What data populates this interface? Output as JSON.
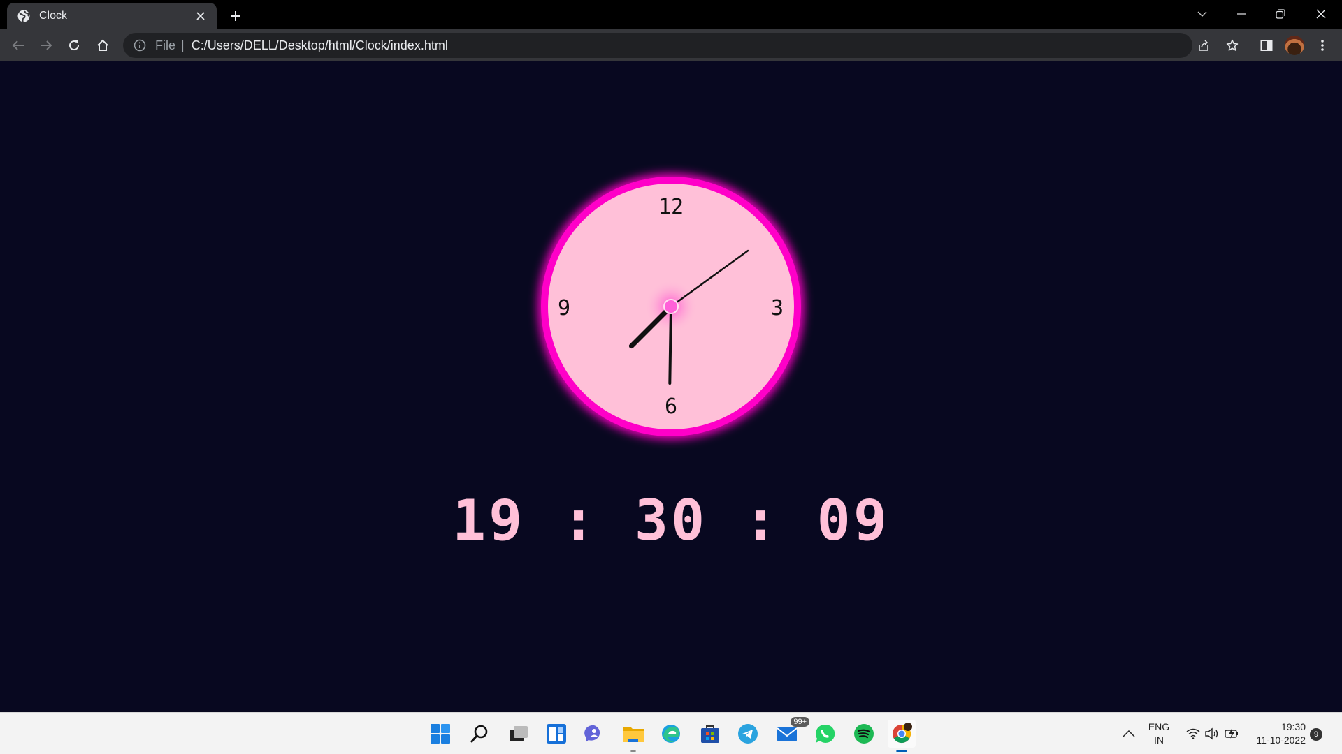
{
  "browser": {
    "tab_title": "Clock",
    "omnibox": {
      "scheme_label": "File",
      "separator": "|",
      "url": "C:/Users/DELL/Desktop/html/Clock/index.html"
    }
  },
  "clock": {
    "numerals": {
      "twelve": "12",
      "three": "3",
      "six": "6",
      "nine": "9"
    },
    "digital": {
      "hours": "19",
      "minutes": "30",
      "seconds": "09",
      "separator": ":"
    },
    "colors": {
      "ring": "#ff00c8",
      "face": "#ffc0d8",
      "hands": "#111111",
      "background": "#080820"
    }
  },
  "taskbar": {
    "apps": [
      "start-icon",
      "search-icon",
      "task-view-icon",
      "widgets-icon",
      "teams-chat-icon",
      "file-explorer-icon",
      "edge-icon",
      "store-icon",
      "telegram-icon",
      "mail-icon",
      "whatsapp-icon",
      "spotify-icon",
      "chrome-icon"
    ],
    "mail_badge": "99+",
    "language": {
      "line1": "ENG",
      "line2": "IN"
    },
    "time": "19:30",
    "date": "11-10-2022",
    "notification_count": "9"
  }
}
